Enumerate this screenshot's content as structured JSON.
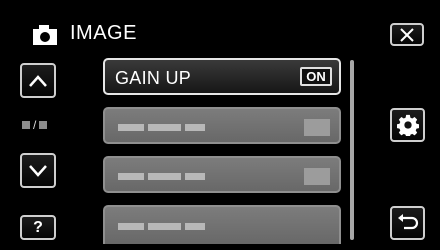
{
  "header": {
    "title": "IMAGE",
    "icon": "camera-icon"
  },
  "nav": {
    "up_icon": "chevron-up-icon",
    "down_icon": "chevron-down-icon",
    "page_indicator_icon": "page-indicator-icon",
    "help_label": "?"
  },
  "right_buttons": {
    "close_icon": "close-icon",
    "settings_icon": "gear-icon",
    "back_icon": "return-icon"
  },
  "menu": {
    "items": [
      {
        "label": "GAIN UP",
        "value": "ON",
        "state": "active"
      },
      {
        "label": "",
        "value": "",
        "state": "disabled"
      },
      {
        "label": "",
        "value": "",
        "state": "disabled"
      },
      {
        "label": "",
        "value": "",
        "state": "disabled"
      }
    ]
  }
}
